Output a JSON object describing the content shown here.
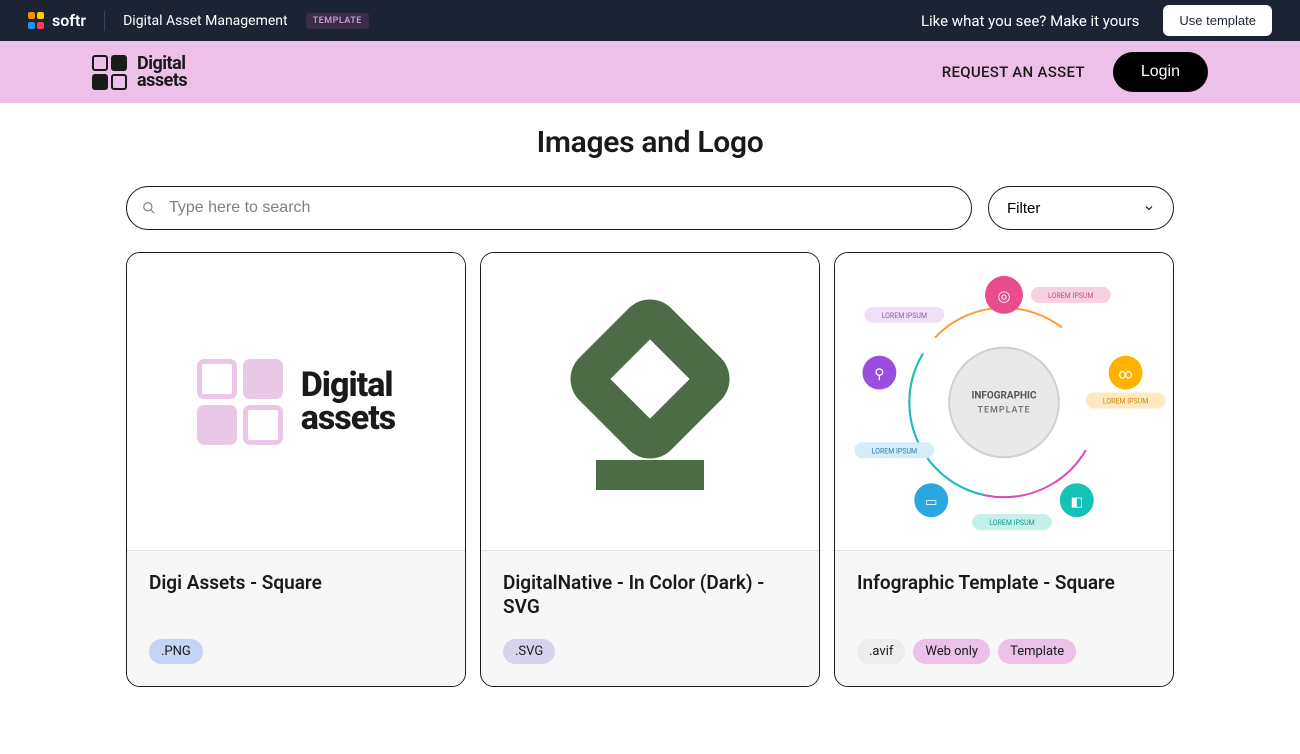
{
  "topbar": {
    "brand": "softr",
    "title": "Digital Asset Management",
    "badge": "TEMPLATE",
    "tagline": "Like what you see? Make it yours",
    "use_template": "Use template"
  },
  "navbar": {
    "logo_line1": "Digital",
    "logo_line2": "assets",
    "request": "REQUEST AN ASSET",
    "login": "Login"
  },
  "page": {
    "title": "Images and Logo"
  },
  "search": {
    "placeholder": "Type here to search"
  },
  "filter": {
    "label": "Filter"
  },
  "cards": [
    {
      "title": "Digi Assets - Square",
      "tags": [
        ".PNG"
      ],
      "image_logo_line1": "Digital",
      "image_logo_line2": "assets"
    },
    {
      "title": "DigitalNative - In Color (Dark) - SVG",
      "tags": [
        ".SVG"
      ]
    },
    {
      "title": "Infographic Template - Square",
      "tags": [
        ".avif",
        "Web only",
        "Template"
      ],
      "infographic_title": "INFOGRAPHIC",
      "infographic_subtitle": "TEMPLATE",
      "lorem": "LOREM IPSUM"
    }
  ]
}
